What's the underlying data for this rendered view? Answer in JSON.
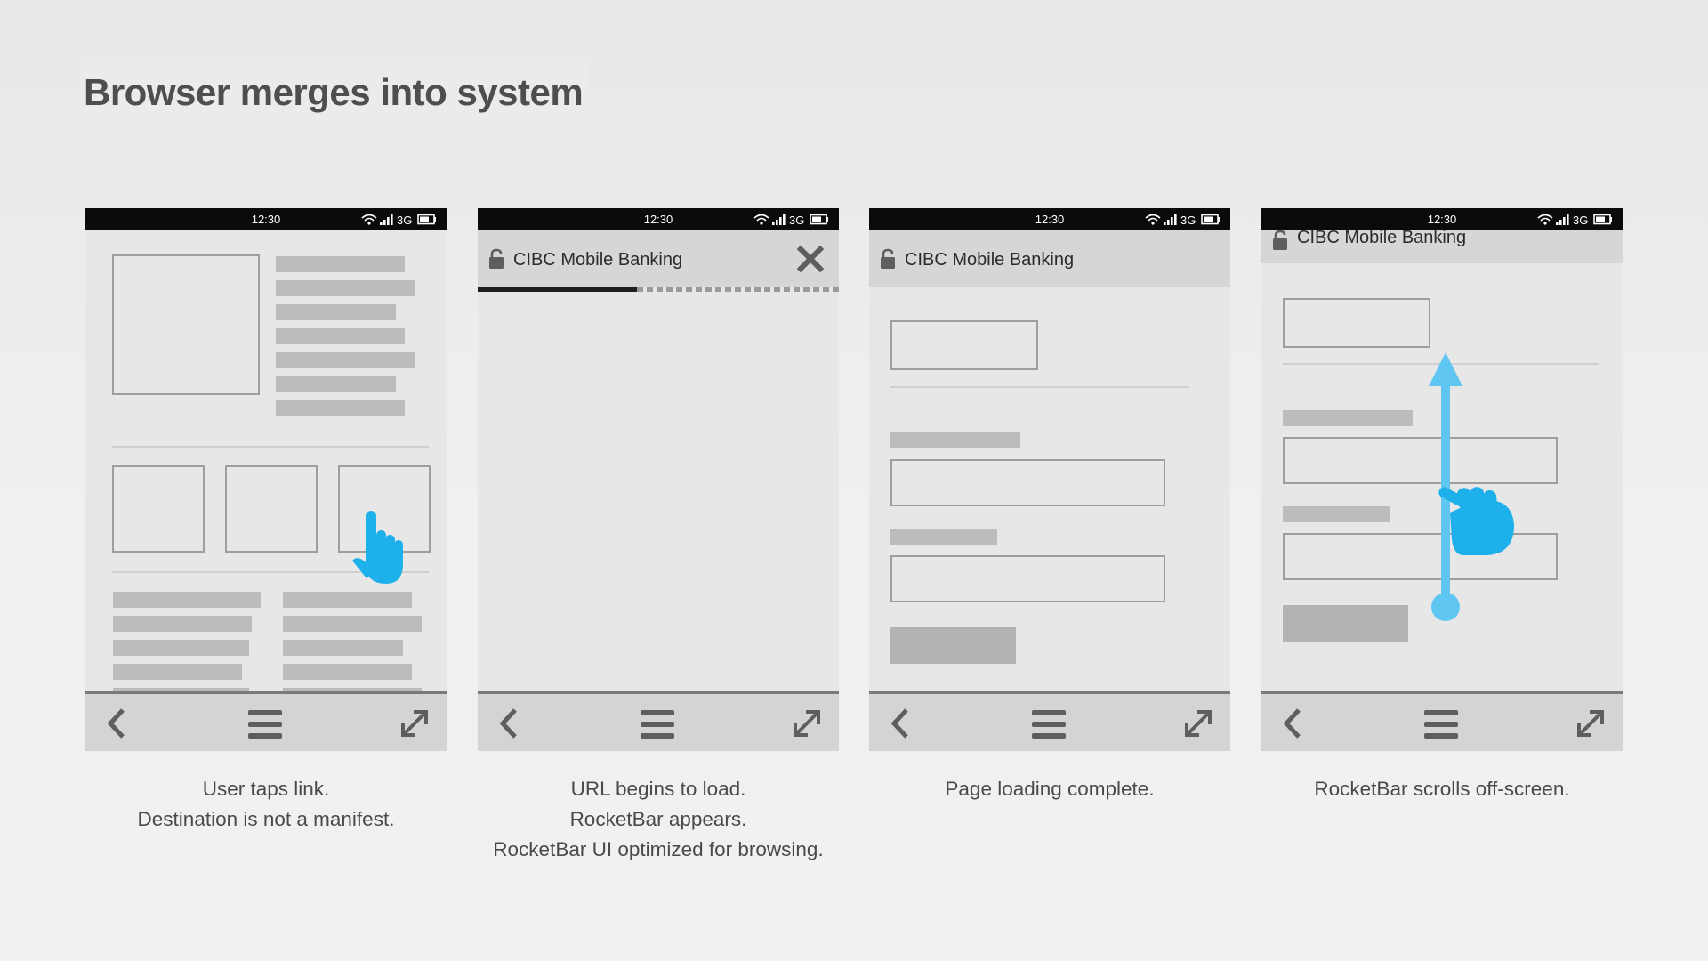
{
  "title": "Browser merges into system",
  "accent_color": "#1eb0ea",
  "status_bar": {
    "time": "12:30",
    "network": "3G"
  },
  "icons": {
    "status": [
      "wifi-icon",
      "signal-icon",
      "battery-icon"
    ],
    "urlbar": [
      "lock-icon",
      "close-icon"
    ],
    "toolbar": [
      "back-chevron-icon",
      "menu-icon",
      "expand-icon"
    ],
    "gestures": [
      "hand-tap-icon",
      "hand-swipe-icon",
      "swipe-up-arrow-icon"
    ]
  },
  "panels": [
    {
      "caption": [
        "User taps link.",
        "Destination is not a manifest."
      ]
    },
    {
      "url_title": "CIBC Mobile Banking",
      "load_progress": 0.44,
      "caption": [
        "URL begins to load.",
        "RocketBar appears.",
        "RocketBar UI optimized for browsing."
      ]
    },
    {
      "url_title": "CIBC Mobile Banking",
      "caption": [
        "Page loading complete."
      ]
    },
    {
      "url_title": "CIBC Mobile Banking",
      "caption": [
        "RocketBar scrolls off-screen."
      ]
    }
  ]
}
